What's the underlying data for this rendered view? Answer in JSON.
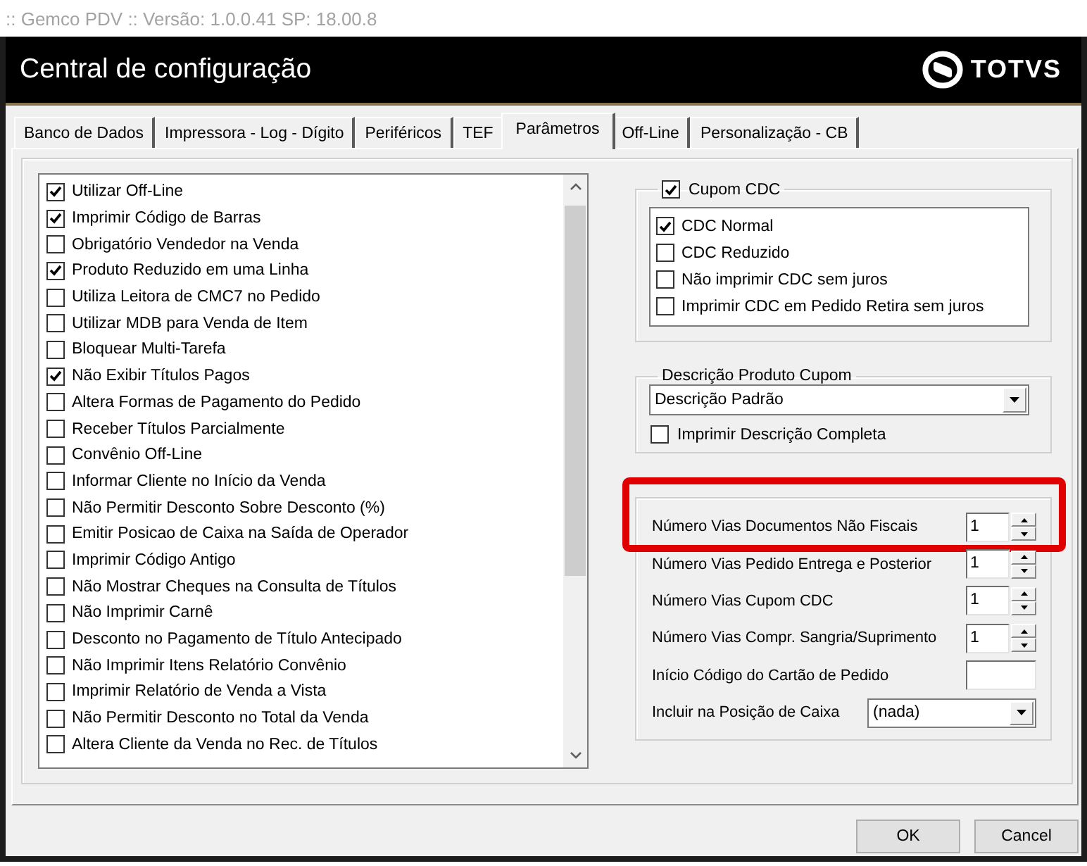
{
  "window": {
    "app_title": ":: Gemco PDV :: Versão: 1.0.0.41 SP: 18.00.8",
    "title": "Central de configuração",
    "brand": "TOTVS"
  },
  "tabs": [
    {
      "label": "Banco de Dados",
      "selected": false
    },
    {
      "label": "Impressora - Log - Dígito",
      "selected": false
    },
    {
      "label": "Periféricos",
      "selected": false
    },
    {
      "label": "TEF",
      "selected": false
    },
    {
      "label": "Parâmetros",
      "selected": true
    },
    {
      "label": "Off-Line",
      "selected": false
    },
    {
      "label": "Personalização - CB",
      "selected": false
    }
  ],
  "options_list": {
    "items": [
      {
        "label": "Utilizar Off-Line",
        "checked": true
      },
      {
        "label": "Imprimir Código de Barras",
        "checked": true
      },
      {
        "label": "Obrigatório Vendedor na Venda",
        "checked": false
      },
      {
        "label": "Produto Reduzido em uma Linha",
        "checked": true
      },
      {
        "label": "Utiliza Leitora de CMC7 no Pedido",
        "checked": false
      },
      {
        "label": "Utilizar MDB para Venda de Item",
        "checked": false
      },
      {
        "label": "Bloquear Multi-Tarefa",
        "checked": false
      },
      {
        "label": "Não Exibir Títulos Pagos",
        "checked": true
      },
      {
        "label": "Altera Formas de Pagamento do Pedido",
        "checked": false
      },
      {
        "label": "Receber Títulos Parcialmente",
        "checked": false
      },
      {
        "label": "Convênio Off-Line",
        "checked": false
      },
      {
        "label": "Informar Cliente no Início da Venda",
        "checked": false
      },
      {
        "label": "Não Permitir Desconto Sobre Desconto (%)",
        "checked": false
      },
      {
        "label": "Emitir Posicao de Caixa na Saída de Operador",
        "checked": false
      },
      {
        "label": "Imprimir Código Antigo",
        "checked": false
      },
      {
        "label": "Não Mostrar Cheques na Consulta de Títulos",
        "checked": false
      },
      {
        "label": "Não Imprimir Carnê",
        "checked": false
      },
      {
        "label": "Desconto no Pagamento de Título Antecipado",
        "checked": false
      },
      {
        "label": "Não Imprimir Itens Relatório Convênio",
        "checked": false
      },
      {
        "label": "Imprimir Relatório de Venda a Vista",
        "checked": false
      },
      {
        "label": "Não Permitir Desconto no Total da Venda",
        "checked": false
      },
      {
        "label": "Altera Cliente da Venda no Rec. de Títulos",
        "checked": false
      }
    ]
  },
  "cupom_cdc": {
    "label": "Cupom CDC",
    "checked": true,
    "items": [
      {
        "label": "CDC Normal",
        "checked": true
      },
      {
        "label": "CDC Reduzido",
        "checked": false
      },
      {
        "label": "Não imprimir CDC sem juros",
        "checked": false
      },
      {
        "label": "Imprimir CDC em Pedido Retira sem juros",
        "checked": false
      }
    ]
  },
  "descricao_produto_cupom": {
    "label": "Descrição Produto Cupom",
    "value": "Descrição Padrão",
    "option": {
      "label": "Imprimir Descrição Completa",
      "checked": false
    }
  },
  "vias": {
    "rows": [
      {
        "kind": "spin",
        "label": "Número Vias Documentos Não Fiscais",
        "value": "1",
        "highlighted": true
      },
      {
        "kind": "spin",
        "label": "Número Vias Pedido Entrega e Posterior",
        "value": "1",
        "highlighted": false
      },
      {
        "kind": "spin",
        "label": "Número Vias Cupom CDC",
        "value": "1",
        "highlighted": false
      },
      {
        "kind": "spin",
        "label": "Número Vias Compr. Sangria/Suprimento",
        "value": "1",
        "highlighted": false
      },
      {
        "kind": "text",
        "label": "Início Código do Cartão de Pedido",
        "highlighted": false
      },
      {
        "kind": "select",
        "label": "Incluir na Posição de Caixa",
        "value": "(nada)",
        "highlighted": false
      }
    ]
  },
  "buttons": [
    {
      "label": "OK"
    },
    {
      "label": "Cancel"
    }
  ]
}
